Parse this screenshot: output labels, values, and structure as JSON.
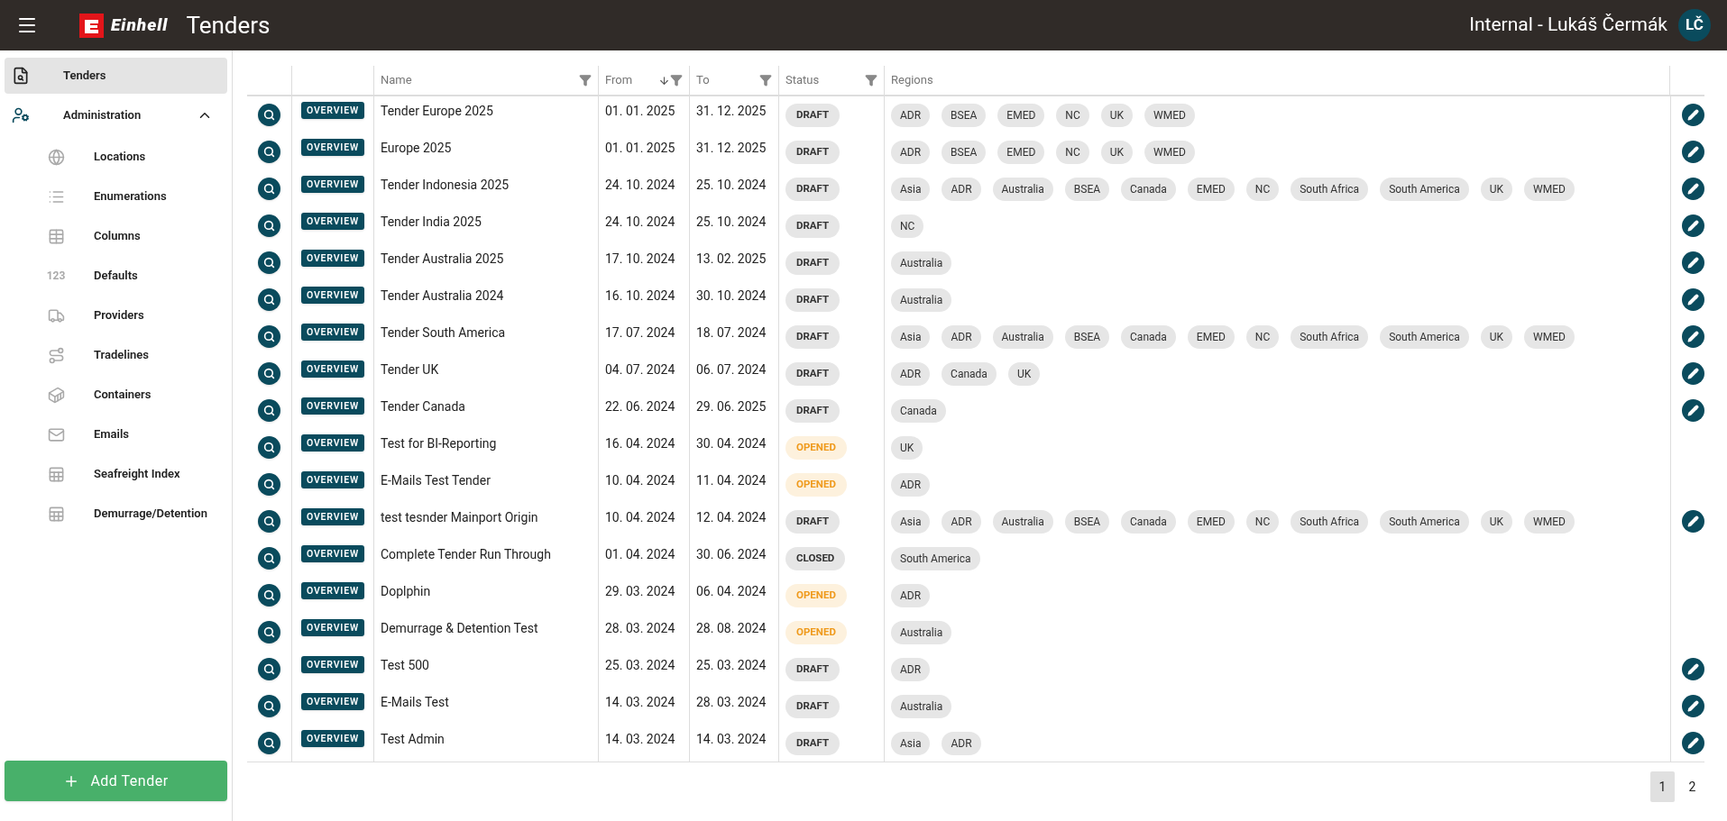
{
  "header": {
    "title": "Tenders",
    "logo_text": "Einhell",
    "user": "Internal - Lukáš Čermák",
    "avatar": "LČ"
  },
  "sidebar": {
    "items": [
      {
        "label": "Tenders",
        "selected": true
      },
      {
        "label": "Administration",
        "selected": false,
        "expanded": true,
        "children": [
          {
            "label": "Locations"
          },
          {
            "label": "Enumerations"
          },
          {
            "label": "Columns"
          },
          {
            "label": "Defaults",
            "icon_text": "123"
          },
          {
            "label": "Providers"
          },
          {
            "label": "Tradelines"
          },
          {
            "label": "Containers"
          },
          {
            "label": "Emails"
          },
          {
            "label": "Seafreight Index"
          },
          {
            "label": "Demurrage/Detention"
          }
        ]
      }
    ],
    "add_button": "Add Tender"
  },
  "table": {
    "columns": [
      {
        "label": "Name",
        "filter": true
      },
      {
        "label": "From",
        "filter": true,
        "sorted": true
      },
      {
        "label": "To",
        "filter": true
      },
      {
        "label": "Status",
        "filter": true
      },
      {
        "label": "Regions"
      }
    ],
    "rows": [
      {
        "overview": "OVERVIEW",
        "name": "Tender Europe 2025",
        "from": "01. 01. 2025",
        "to": "31. 12. 2025",
        "status": "DRAFT",
        "kind": "draft",
        "regions": [
          "ADR",
          "BSEA",
          "EMED",
          "NC",
          "UK",
          "WMED"
        ],
        "editable": true
      },
      {
        "overview": "OVERVIEW",
        "name": "Europe 2025",
        "from": "01. 01. 2025",
        "to": "31. 12. 2025",
        "status": "DRAFT",
        "kind": "draft",
        "regions": [
          "ADR",
          "BSEA",
          "EMED",
          "NC",
          "UK",
          "WMED"
        ],
        "editable": true
      },
      {
        "overview": "OVERVIEW",
        "name": "Tender Indonesia 2025",
        "from": "24. 10. 2024",
        "to": "25. 10. 2024",
        "status": "DRAFT",
        "kind": "draft",
        "regions": [
          "Asia",
          "ADR",
          "Australia",
          "BSEA",
          "Canada",
          "EMED",
          "NC",
          "South Africa",
          "South America",
          "UK",
          "WMED"
        ],
        "editable": true
      },
      {
        "overview": "OVERVIEW",
        "name": "Tender India 2025",
        "from": "24. 10. 2024",
        "to": "25. 10. 2024",
        "status": "DRAFT",
        "kind": "draft",
        "regions": [
          "NC"
        ],
        "editable": true
      },
      {
        "overview": "OVERVIEW",
        "name": "Tender Australia 2025",
        "from": "17. 10. 2024",
        "to": "13. 02. 2025",
        "status": "DRAFT",
        "kind": "draft",
        "regions": [
          "Australia"
        ],
        "editable": true
      },
      {
        "overview": "OVERVIEW",
        "name": "Tender Australia 2024",
        "from": "16. 10. 2024",
        "to": "30. 10. 2024",
        "status": "DRAFT",
        "kind": "draft",
        "regions": [
          "Australia"
        ],
        "editable": true
      },
      {
        "overview": "OVERVIEW",
        "name": "Tender South America",
        "from": "17. 07. 2024",
        "to": "18. 07. 2024",
        "status": "DRAFT",
        "kind": "draft",
        "regions": [
          "Asia",
          "ADR",
          "Australia",
          "BSEA",
          "Canada",
          "EMED",
          "NC",
          "South Africa",
          "South America",
          "UK",
          "WMED"
        ],
        "editable": true
      },
      {
        "overview": "OVERVIEW",
        "name": "Tender UK",
        "from": "04. 07. 2024",
        "to": "06. 07. 2024",
        "status": "DRAFT",
        "kind": "draft",
        "regions": [
          "ADR",
          "Canada",
          "UK"
        ],
        "editable": true
      },
      {
        "overview": "OVERVIEW",
        "name": "Tender Canada",
        "from": "22. 06. 2024",
        "to": "29. 06. 2025",
        "status": "DRAFT",
        "kind": "draft",
        "regions": [
          "Canada"
        ],
        "editable": true
      },
      {
        "overview": "OVERVIEW",
        "name": "Test for BI-Reporting",
        "from": "16. 04. 2024",
        "to": "30. 04. 2024",
        "status": "OPENED",
        "kind": "opened",
        "regions": [
          "UK"
        ],
        "editable": false
      },
      {
        "overview": "OVERVIEW",
        "name": "E-Mails Test Tender",
        "from": "10. 04. 2024",
        "to": "11. 04. 2024",
        "status": "OPENED",
        "kind": "opened",
        "regions": [
          "ADR"
        ],
        "editable": false
      },
      {
        "overview": "OVERVIEW",
        "name": "test tesnder Mainport Origin",
        "from": "10. 04. 2024",
        "to": "12. 04. 2024",
        "status": "DRAFT",
        "kind": "draft",
        "regions": [
          "Asia",
          "ADR",
          "Australia",
          "BSEA",
          "Canada",
          "EMED",
          "NC",
          "South Africa",
          "South America",
          "UK",
          "WMED"
        ],
        "editable": true
      },
      {
        "overview": "OVERVIEW",
        "name": "Complete Tender Run Through",
        "from": "01. 04. 2024",
        "to": "30. 06. 2024",
        "status": "CLOSED",
        "kind": "closed",
        "regions": [
          "South America"
        ],
        "editable": false
      },
      {
        "overview": "OVERVIEW",
        "name": "Doplphin",
        "from": "29. 03. 2024",
        "to": "06. 04. 2024",
        "status": "OPENED",
        "kind": "opened",
        "regions": [
          "ADR"
        ],
        "editable": false
      },
      {
        "overview": "OVERVIEW",
        "name": "Demurrage & Detention Test",
        "from": "28. 03. 2024",
        "to": "28. 08. 2024",
        "status": "OPENED",
        "kind": "opened",
        "regions": [
          "Australia"
        ],
        "editable": false
      },
      {
        "overview": "OVERVIEW",
        "name": "Test 500",
        "from": "25. 03. 2024",
        "to": "25. 03. 2024",
        "status": "DRAFT",
        "kind": "draft",
        "regions": [
          "ADR"
        ],
        "editable": true
      },
      {
        "overview": "OVERVIEW",
        "name": "E-Mails Test",
        "from": "14. 03. 2024",
        "to": "28. 03. 2024",
        "status": "DRAFT",
        "kind": "draft",
        "regions": [
          "Australia"
        ],
        "editable": true
      },
      {
        "overview": "OVERVIEW",
        "name": "Test Admin",
        "from": "14. 03. 2024",
        "to": "14. 03. 2024",
        "status": "DRAFT",
        "kind": "draft",
        "regions": [
          "Asia",
          "ADR"
        ],
        "editable": true
      }
    ]
  },
  "pagination": [
    {
      "label": "1",
      "selected": true
    },
    {
      "label": "2",
      "selected": false
    }
  ]
}
